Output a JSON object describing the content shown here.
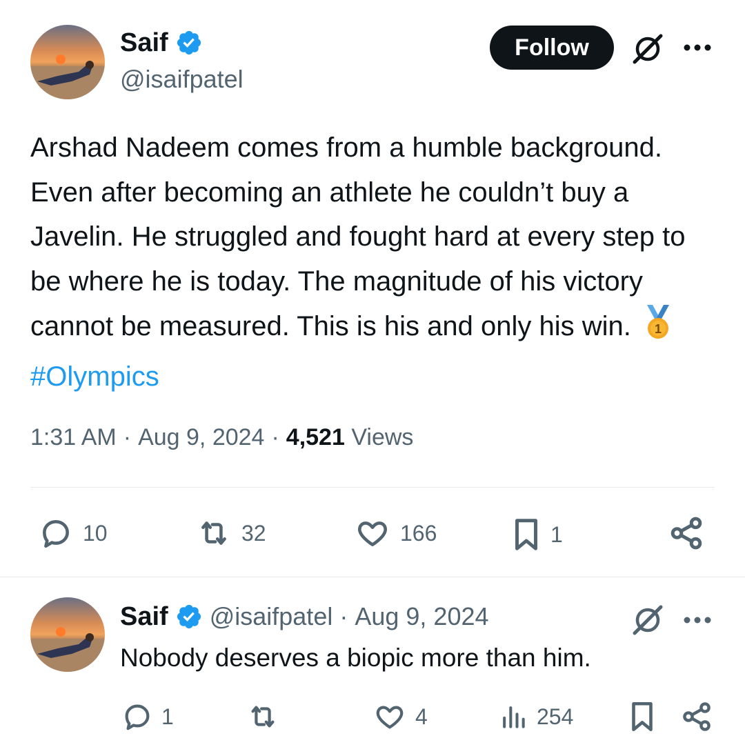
{
  "tweet": {
    "author_name": "Saif",
    "author_handle": "@isaifpatel",
    "follow_label": "Follow",
    "text_before": "Arshad Nadeem comes from a humble background. Even after becoming an athlete he couldn’t buy a Javelin. He struggled and fought hard at every step to be where he is today. The magnitude of his victory cannot be measured. This is his and only his win.",
    "medal_digit": "1",
    "hashtag": "#Olympics",
    "time": "1:31 AM",
    "date": "Aug 9, 2024",
    "views_count": "4,521",
    "views_label": "Views",
    "separator": "·",
    "stats": {
      "replies": "10",
      "reposts": "32",
      "likes": "166",
      "bookmarks": "1"
    }
  },
  "reply": {
    "author_name": "Saif",
    "author_handle": "@isaifpatel",
    "separator": "·",
    "date": "Aug 9, 2024",
    "text": "Nobody deserves a biopic more than him.",
    "stats": {
      "replies": "1",
      "likes": "4",
      "views": "254"
    }
  },
  "colors": {
    "accent": "#1d9bf0",
    "text": "#0f1419",
    "muted": "#536471",
    "divider": "#e7e9ea",
    "gold": "#f5a623"
  },
  "icons": [
    "verified-badge-icon",
    "grok-icon",
    "more-icon",
    "reply-icon",
    "repost-icon",
    "like-icon",
    "bookmark-icon",
    "share-icon",
    "views-icon",
    "medal-icon"
  ]
}
